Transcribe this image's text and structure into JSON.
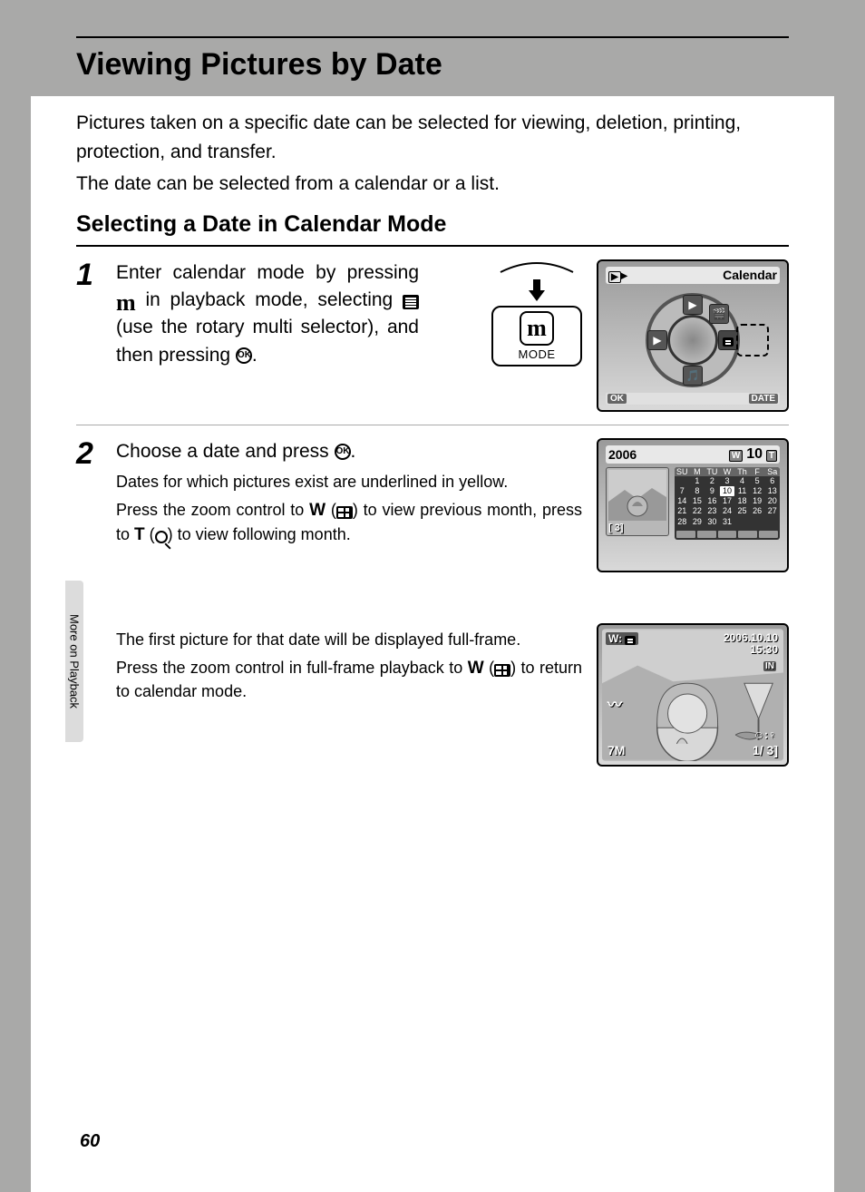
{
  "title": "Viewing Pictures by Date",
  "intro1": "Pictures taken on a specific date can be selected for viewing, deletion, printing, protection, and transfer.",
  "intro2": "The date can be selected from a calendar or a list.",
  "sub_title": "Selecting a Date in Calendar Mode",
  "step1": {
    "num": "1",
    "text_a": "Enter calendar mode by pressing ",
    "text_b": " in playback mode, selecting ",
    "text_c": " (use the rotary multi selector), and then pressing ",
    "text_d": "."
  },
  "mode_button_label": "MODE",
  "lcd1": {
    "play_icon": "▶",
    "title": "Calendar",
    "ok": "OK",
    "date": "DATE"
  },
  "step2": {
    "num": "2",
    "head_a": "Choose a date and press ",
    "head_b": ".",
    "p1": "Dates for which pictures exist are underlined in yellow.",
    "p2_a": "Press the zoom control to ",
    "p2_b": " (",
    "p2_c": ") to view previous month, press to ",
    "p2_d": " (",
    "p2_e": ") to view following month.",
    "p3": "The first picture for that date will be displayed full-frame.",
    "p4_a": "Press the zoom control in full-frame playback to ",
    "p4_b": " (",
    "p4_c": ") to return to calendar mode."
  },
  "calendar": {
    "year": "2006",
    "month_label": "10",
    "w_icon": "W",
    "t_icon": "T",
    "count_label": "[    3]",
    "dow": [
      "SU",
      "M",
      "TU",
      "W",
      "Th",
      "F",
      "Sa"
    ],
    "days": [
      [
        "",
        "1",
        "2",
        "3",
        "4",
        "5",
        "6",
        "7"
      ],
      [
        "8",
        "9",
        "10",
        "11",
        "12",
        "13",
        "14"
      ],
      [
        "15",
        "16",
        "17",
        "18",
        "19",
        "20",
        "21"
      ],
      [
        "22",
        "23",
        "24",
        "25",
        "26",
        "27",
        "28"
      ],
      [
        "29",
        "30",
        "31",
        "",
        "",
        "",
        ""
      ]
    ],
    "selected_day": "10"
  },
  "playback": {
    "w_label": "W:",
    "date": "2006.10.10",
    "time": "15:30",
    "in_label": "IN",
    "size_label": "7M",
    "face_label": "☺:♀",
    "count": "1/      3]"
  },
  "side_tab": "More on Playback",
  "page_num": "60"
}
